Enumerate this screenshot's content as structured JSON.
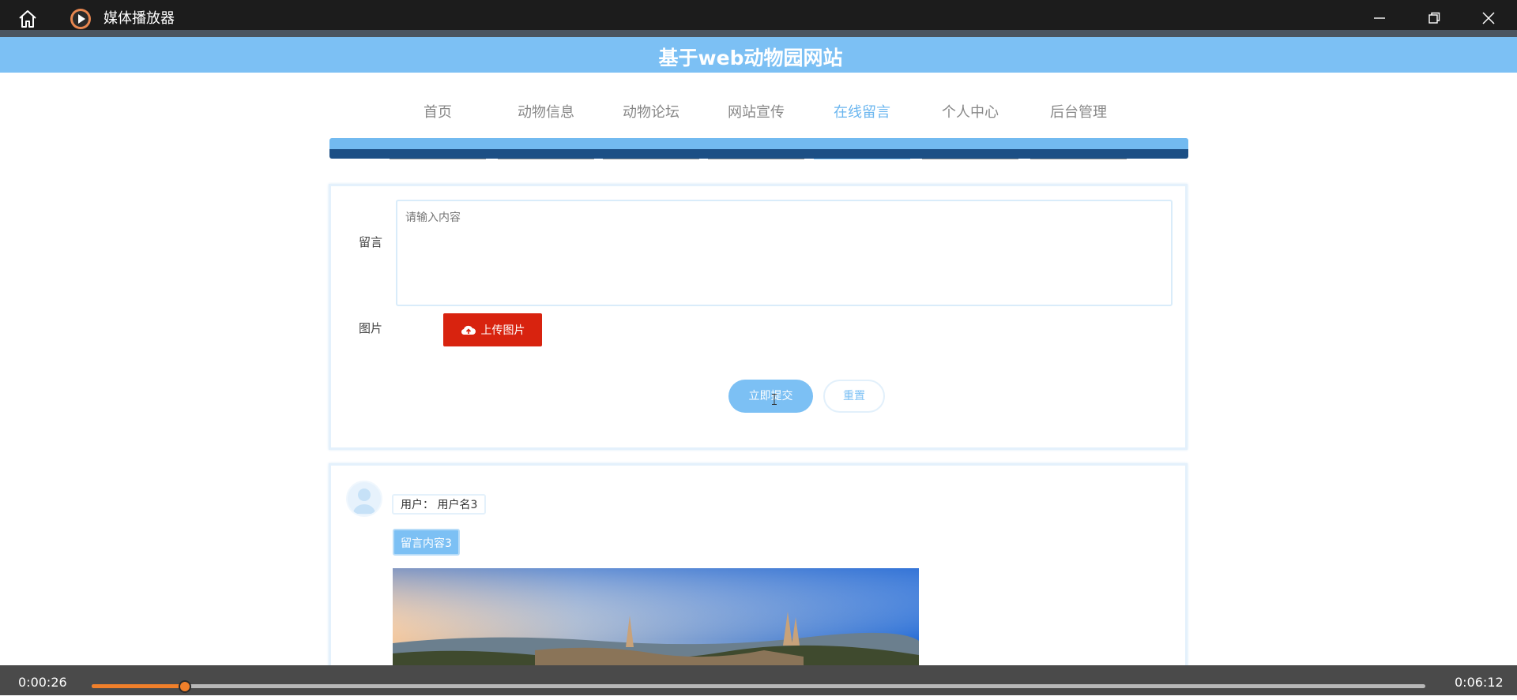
{
  "window": {
    "title": "媒体播放器"
  },
  "site": {
    "title": "基于web动物园网站",
    "nav": [
      {
        "label": "首页",
        "active": false
      },
      {
        "label": "动物信息",
        "active": false
      },
      {
        "label": "动物论坛",
        "active": false
      },
      {
        "label": "网站宣传",
        "active": false
      },
      {
        "label": "在线留言",
        "active": true
      },
      {
        "label": "个人中心",
        "active": false
      },
      {
        "label": "后台管理",
        "active": false
      }
    ]
  },
  "form": {
    "message_label": "留言",
    "message_placeholder": "请输入内容",
    "image_label": "图片",
    "upload_label": "上传图片",
    "submit_label": "立即提交",
    "reset_label": "重置"
  },
  "messages": [
    {
      "user_text": "用户：  用户名3",
      "content": "留言内容3"
    }
  ],
  "player": {
    "current_time": "0:00:26",
    "total_time": "0:06:12",
    "progress": 0.07
  },
  "colors": {
    "accent": "#7cc0f4",
    "upload_button": "#d8230f",
    "progress": "#f07f2a"
  }
}
